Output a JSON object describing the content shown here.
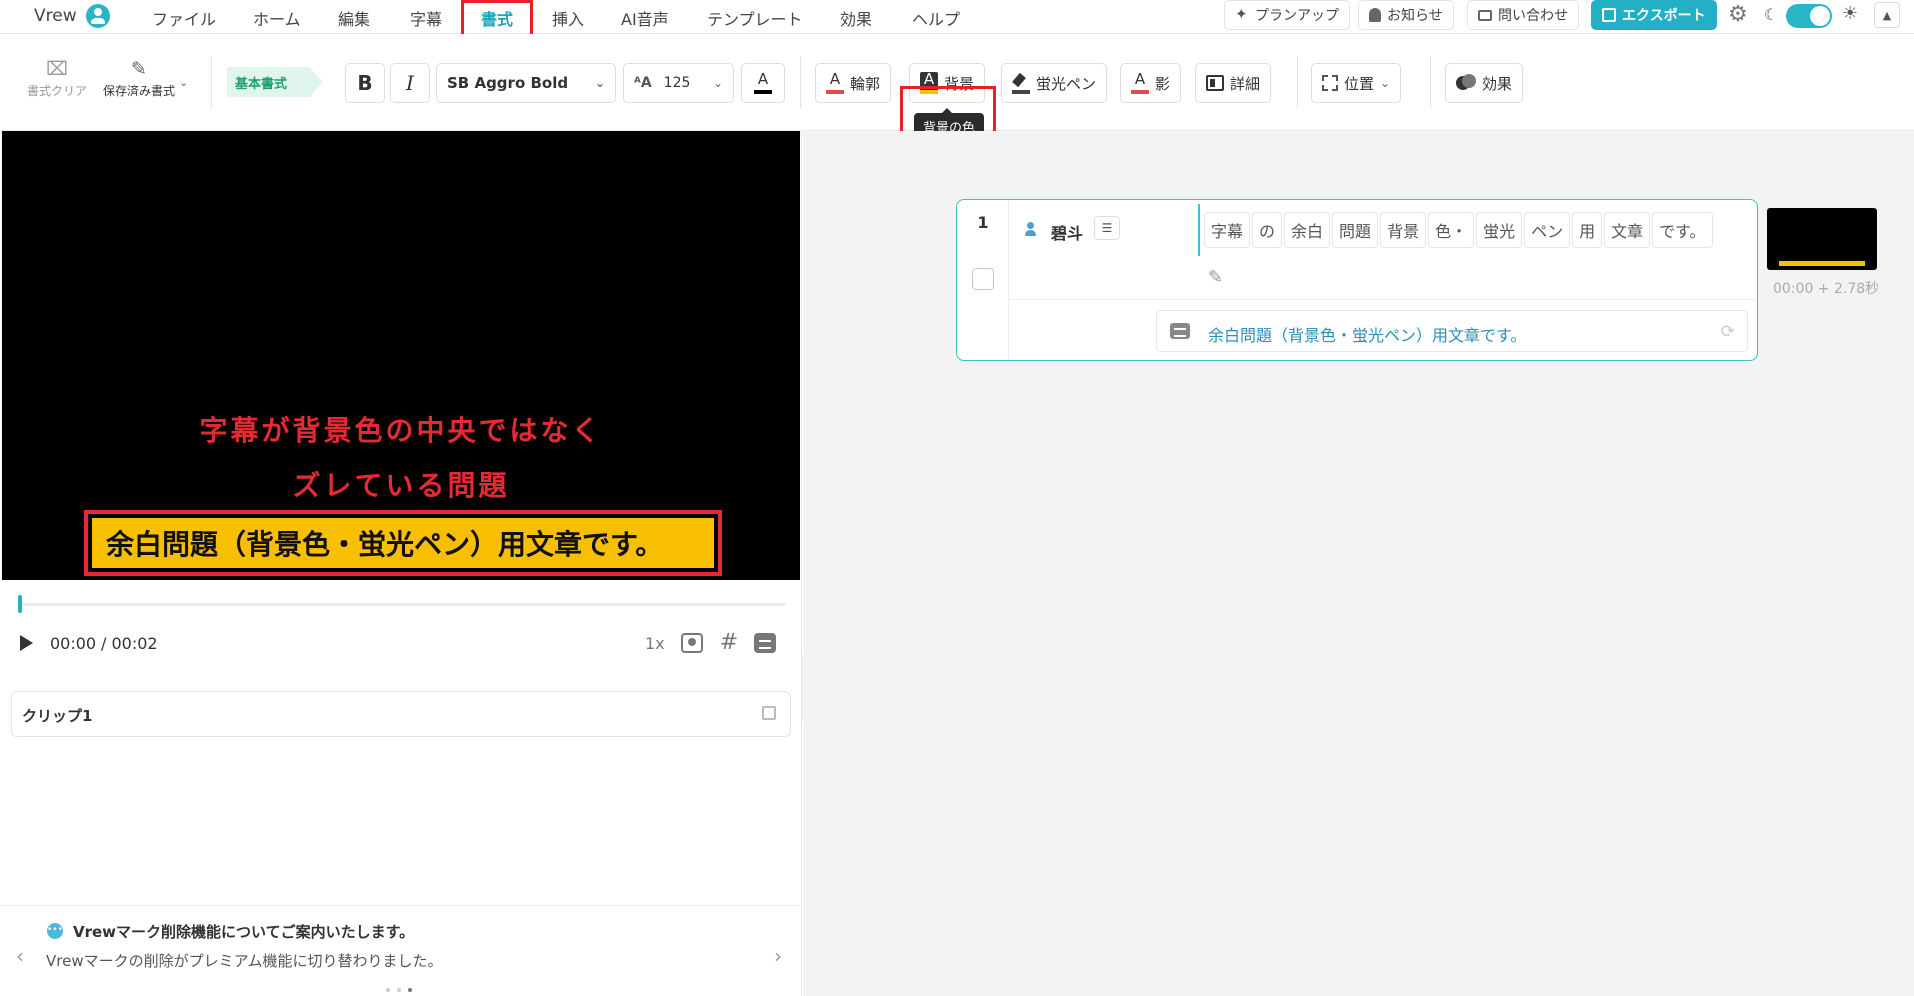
{
  "menubar": {
    "brand": "Vrew",
    "items": [
      "ファイル",
      "ホーム",
      "編集",
      "字幕",
      "書式",
      "挿入",
      "AI音声",
      "テンプレート",
      "効果",
      "ヘルプ"
    ],
    "active_index": 4,
    "plan_up": "プランアップ",
    "notifications": "お知らせ",
    "contact": "問い合わせ",
    "export": "エクスポート",
    "icons": [
      "user-avatar-icon",
      "sparkle-icon",
      "bell-icon",
      "mail-icon",
      "export-icon",
      "gear-icon",
      "moon-icon",
      "sun-icon",
      "chevron-up-icon"
    ]
  },
  "toolbar": {
    "clear_format": "書式クリア",
    "saved_format": "保存済み書式",
    "basic_format_tag": "基本書式",
    "bold": "B",
    "italic": "I",
    "font_family": "SB Aggro Bold",
    "font_size": "125",
    "font_color_glyph": "A",
    "outline": "輪郭",
    "background": "背景",
    "highlighter": "蛍光ペン",
    "shadow": "影",
    "details": "詳細",
    "position": "位置",
    "effects": "効果",
    "tooltip_background": "背景の色",
    "colors": {
      "outline_bar": "#e24b4b",
      "background_bar": "#f5c400",
      "accent": "#23b0c4",
      "highlight_annotation": "#e8202a"
    }
  },
  "preview": {
    "annotation_line1": "字幕が背景色の中央ではなく",
    "annotation_line2": "ズレている問題",
    "subtitle_text": "余白問題（背景色・蛍光ペン）用文章です。",
    "colors": {
      "annotation_text": "#e42b33",
      "subtitle_bg": "#f8be00",
      "canvas": "#000000"
    }
  },
  "player": {
    "current_time": "00:00",
    "duration": "/ 00:02",
    "speed": "1x",
    "progress_fraction": 0.0
  },
  "clip_card": {
    "title": "クリップ1"
  },
  "notice": {
    "title": "Vrewマーク削除機能についてご案内いたします。",
    "body": "Vrewマークの削除がプレミアム機能に切り替わりました。",
    "page_index": 3,
    "page_count": 3
  },
  "timeline": {
    "rows": [
      {
        "number": "1",
        "speaker": "碧斗",
        "words": [
          "字幕",
          "の",
          "余白",
          "問題",
          "背景",
          "色・",
          "蛍光",
          "ペン",
          "用",
          "文章",
          "です。"
        ],
        "subtitle": "余白問題（背景色・蛍光ペン）用文章です。",
        "timecode": "00:00 + 2.78秒"
      }
    ]
  }
}
